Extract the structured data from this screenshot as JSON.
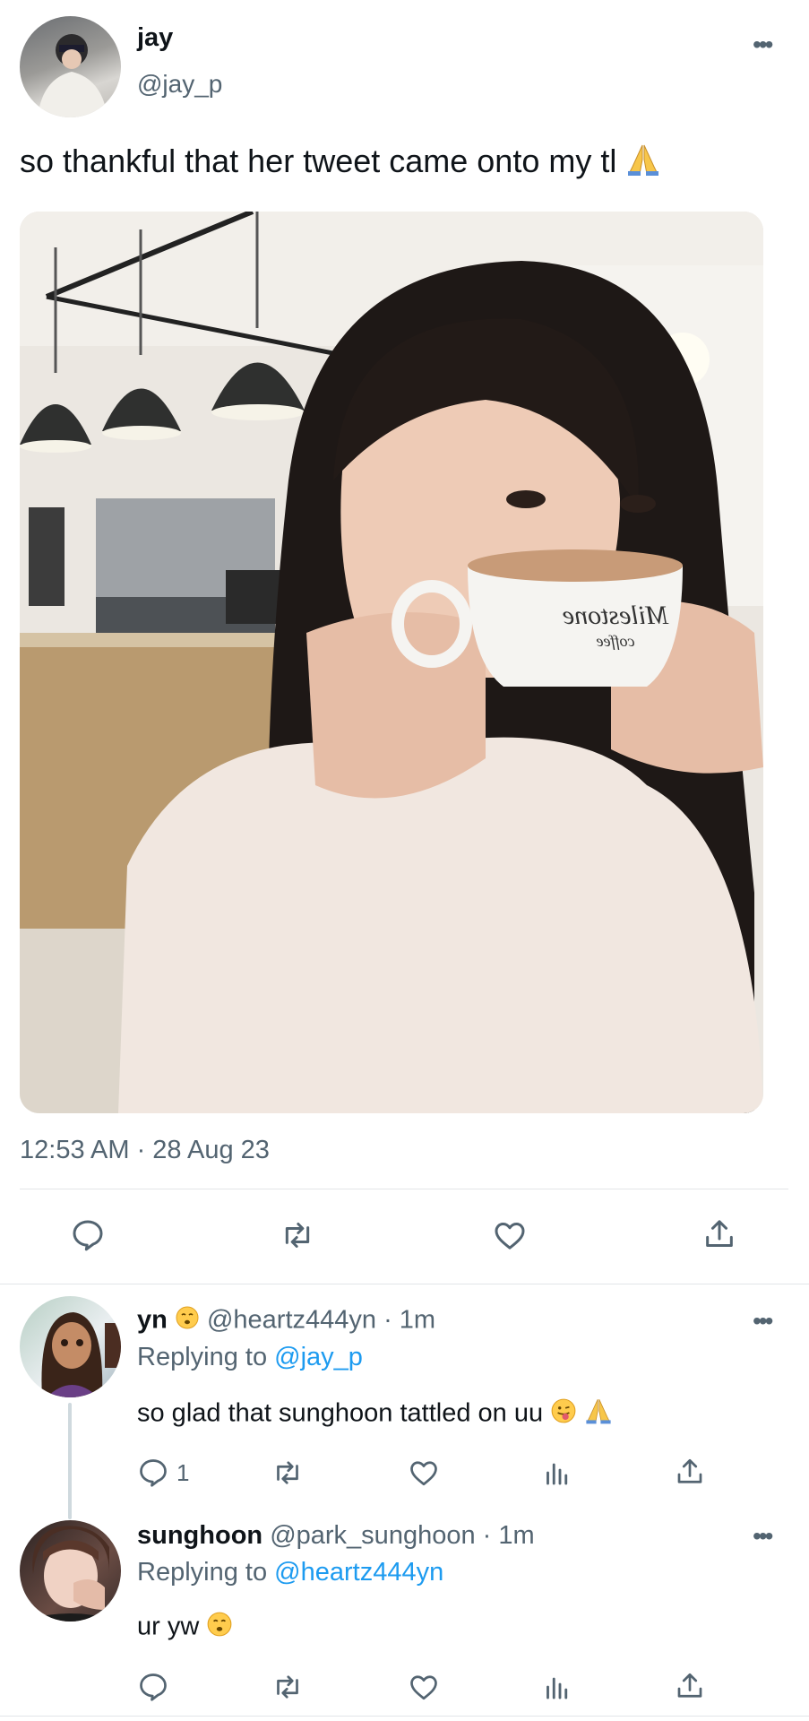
{
  "tweet": {
    "author_name": "jay",
    "author_handle": "@jay_p",
    "text": "so thankful that her tweet came onto my tl",
    "timestamp": "12:53 AM · 28 Aug 23"
  },
  "replies": [
    {
      "name": "yn",
      "handle_time": "@heartz444yn · 1m",
      "replying_prefix": "Replying to",
      "replying_to": "@jay_p",
      "text": "so glad that sunghoon tattled on uu",
      "reply_count": "1"
    },
    {
      "name": "sunghoon",
      "handle_time": "@park_sunghoon · 1m",
      "replying_prefix": "Replying to",
      "replying_to": "@heartz444yn",
      "text": "ur yw",
      "reply_count": ""
    }
  ],
  "colors": {
    "link": "#1d9bf0",
    "muted": "#536471",
    "divider": "#e2e5e8"
  },
  "icons": [
    "more-icon",
    "reply-icon",
    "retweet-icon",
    "like-icon",
    "share-icon",
    "views-icon",
    "pray-emoji",
    "smile-emoji",
    "tongue-emoji"
  ]
}
